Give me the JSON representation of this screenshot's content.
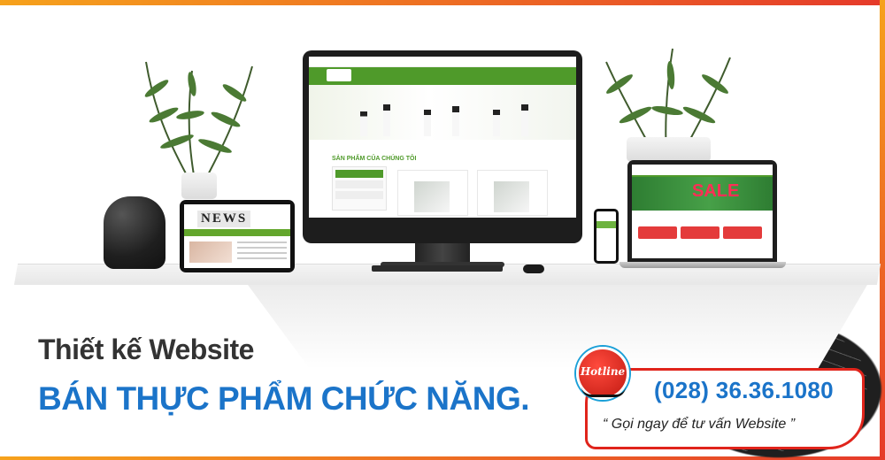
{
  "headline": {
    "line1": "Thiết kế Website",
    "line2": "BÁN THỰC PHẨM CHỨC NĂNG."
  },
  "hotline": {
    "label": "Hotline",
    "number": "(028) 36.36.1080",
    "cta": "“ Gọi ngay để tư vấn Website ”"
  },
  "devices": {
    "tablet_text": "NEWS",
    "monitor_section": "SẢN PHẨM CỦA CHÚNG TÔI",
    "laptop_sale": "SALE"
  },
  "colors": {
    "headline_blue": "#1b74c9",
    "accent_red": "#e0241b",
    "brand_green": "#4f9a2a"
  },
  "icons": [
    "hotline-headset-icon"
  ]
}
